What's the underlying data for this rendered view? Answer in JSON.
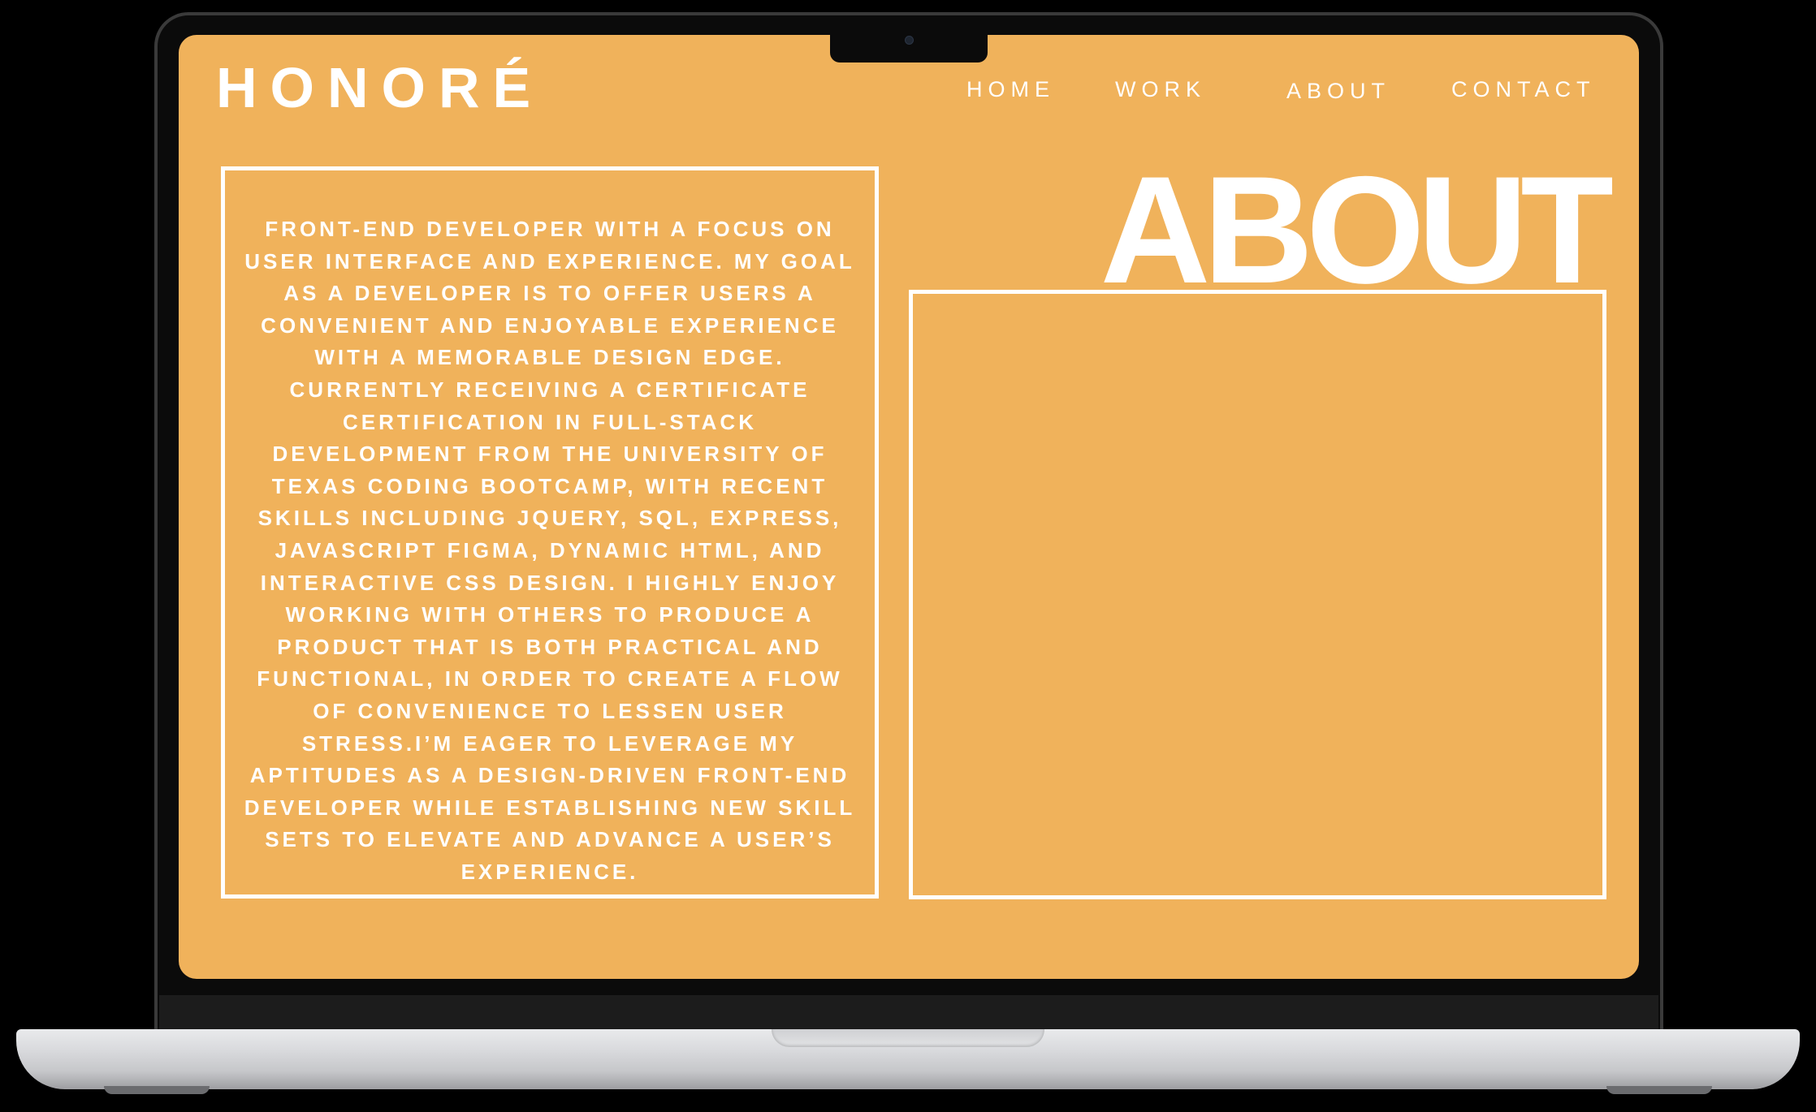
{
  "site": {
    "brand": "HONORÉ",
    "accent_color": "#f0b25b",
    "text_color": "#ffffff"
  },
  "nav": {
    "items": [
      {
        "label": "HOME"
      },
      {
        "label": "WORK"
      },
      {
        "label": "ABOUT"
      },
      {
        "label": "CONTACT"
      }
    ]
  },
  "about": {
    "heading": "ABOUT",
    "bio": "FRONT-END DEVELOPER WITH A FOCUS ON USER INTERFACE AND EXPERIENCE. MY GOAL AS A DEVELOPER IS TO OFFER USERS A CONVENIENT AND ENJOYABLE EXPERIENCE WITH A MEMORABLE DESIGN EDGE. CURRENTLY RECEIVING A CERTIFICATE CERTIFICATION IN FULL-STACK DEVELOPMENT FROM THE UNIVERSITY OF TEXAS CODING BOOTCAMP, WITH RECENT SKILLS INCLUDING JQUERY, SQL, EXPRESS, JAVASCRIPT FIGMA, DYNAMIC HTML, AND INTERACTIVE CSS DESIGN. I HIGHLY ENJOY WORKING WITH OTHERS TO PRODUCE A PRODUCT THAT IS BOTH PRACTICAL AND FUNCTIONAL, IN ORDER TO CREATE A FLOW OF CONVENIENCE TO LESSEN USER STRESS.I’M EAGER TO LEVERAGE MY APTITUDES AS A DESIGN-DRIVEN FRONT-END DEVELOPER WHILE ESTABLISHING NEW SKILL SETS TO ELEVATE AND ADVANCE A USER’S EXPERIENCE."
  }
}
